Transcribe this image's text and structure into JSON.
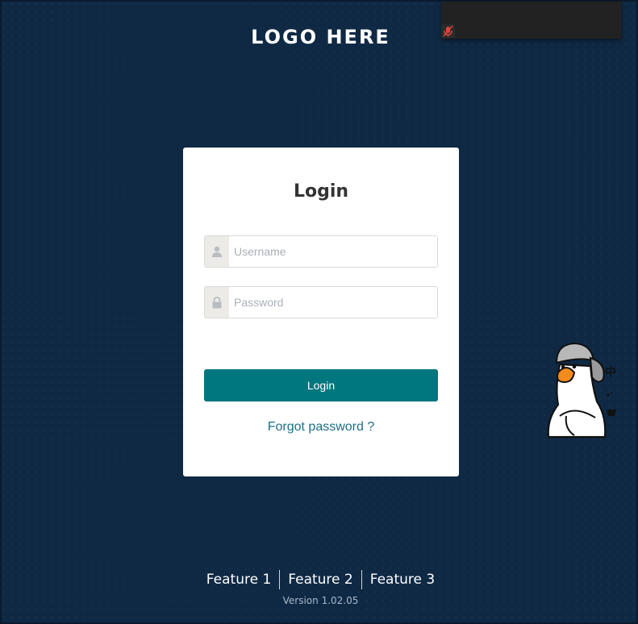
{
  "header": {
    "logo_text": "LOGO HERE"
  },
  "login_form": {
    "title": "Login",
    "username": {
      "value": "",
      "placeholder": "Username",
      "icon": "user-icon"
    },
    "password": {
      "value": "",
      "placeholder": "Password",
      "icon": "lock-icon"
    },
    "submit_label": "Login",
    "forgot_password_label": "Forgot password ?"
  },
  "footer": {
    "features": [
      {
        "label": "Feature 1"
      },
      {
        "label": "Feature 2"
      },
      {
        "label": "Feature 3"
      }
    ],
    "version": "Version 1.02.05"
  },
  "overlay": {
    "icon": "mic-muted-icon"
  },
  "mascot": {
    "icon": "goose-mascot-icon",
    "glyph": "中"
  },
  "colors": {
    "background": "#0f2945",
    "card": "#ffffff",
    "primary_button": "#00767e",
    "link": "#1e6f86",
    "input_icon_bg": "#ecebe8"
  }
}
